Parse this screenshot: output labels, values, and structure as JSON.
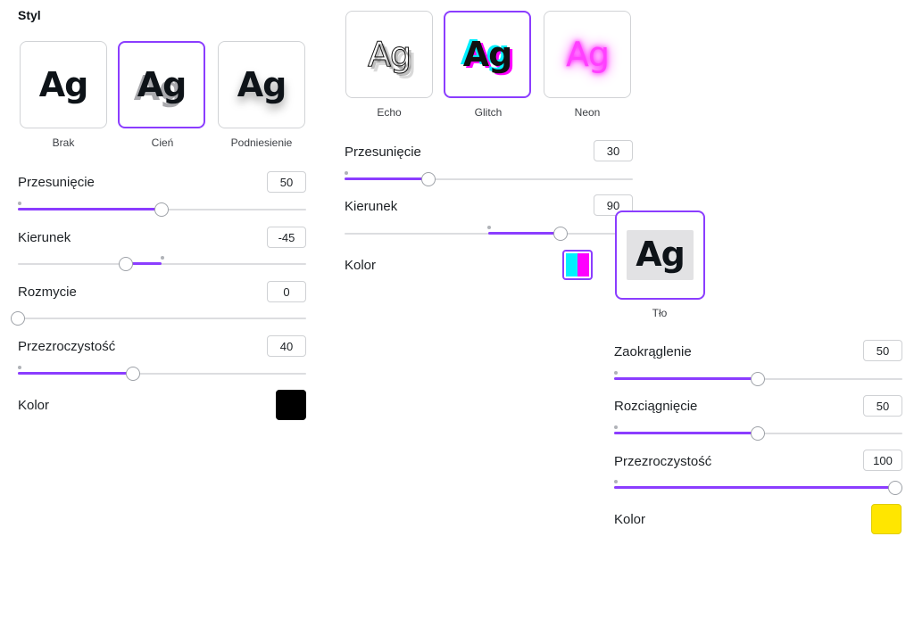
{
  "left_panel": {
    "title": "Styl",
    "styles": [
      {
        "preview": "Ag",
        "caption": "Brak"
      },
      {
        "preview": "Ag",
        "caption": "Cień"
      },
      {
        "preview": "Ag",
        "caption": "Podniesienie"
      }
    ],
    "controls": {
      "offset": {
        "label": "Przesunięcie",
        "value": "50"
      },
      "direction": {
        "label": "Kierunek",
        "value": "-45"
      },
      "blur": {
        "label": "Rozmycie",
        "value": "0"
      },
      "opacity": {
        "label": "Przezroczystość",
        "value": "40"
      },
      "color": {
        "label": "Kolor",
        "hex": "#000000"
      }
    }
  },
  "middle_panel": {
    "styles": [
      {
        "preview": "Ag",
        "caption": "Echo"
      },
      {
        "preview": "Ag",
        "caption": "Glitch"
      },
      {
        "preview": "Ag",
        "caption": "Neon"
      }
    ],
    "controls": {
      "offset": {
        "label": "Przesunięcie",
        "value": "30"
      },
      "direction": {
        "label": "Kierunek",
        "value": "90"
      },
      "color": {
        "label": "Kolor",
        "colors": [
          "#00f0ff",
          "#ff00ff"
        ]
      }
    }
  },
  "right_panel": {
    "style": {
      "preview": "Ag",
      "caption": "Tło"
    },
    "controls": {
      "roundness": {
        "label": "Zaokrąglenie",
        "value": "50"
      },
      "spread": {
        "label": "Rozciągnięcie",
        "value": "50"
      },
      "opacity": {
        "label": "Przezroczystość",
        "value": "100"
      },
      "color": {
        "label": "Kolor",
        "hex": "#ffe600"
      }
    }
  },
  "accent_color": "#8b3dff"
}
